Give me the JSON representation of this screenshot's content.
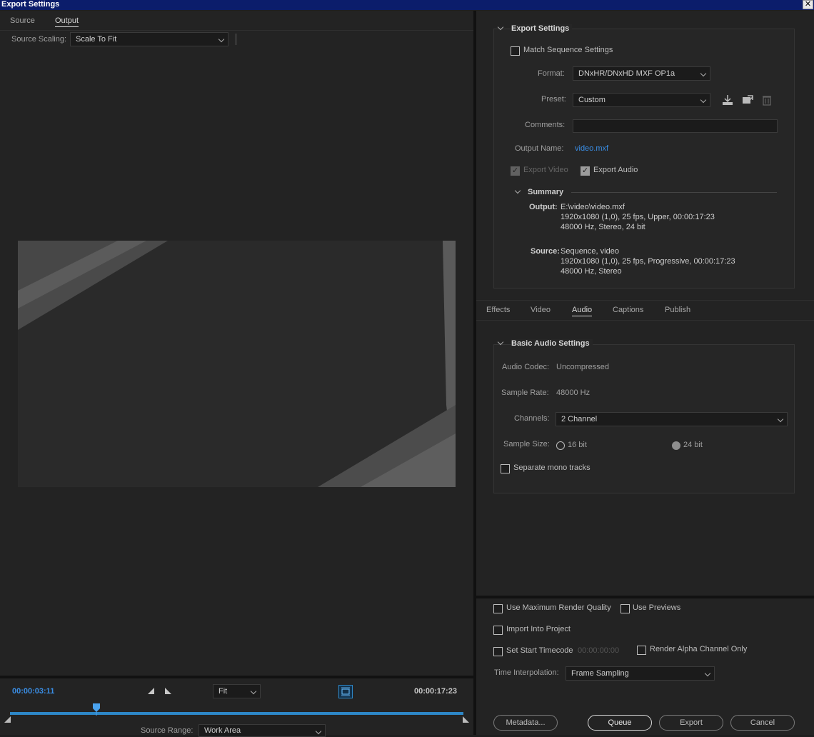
{
  "window": {
    "title": "Export Settings",
    "close_glyph": "✕"
  },
  "left": {
    "tabs": [
      {
        "label": "Source",
        "active": false
      },
      {
        "label": "Output",
        "active": true
      }
    ],
    "source_scaling": {
      "label": "Source Scaling:",
      "value": "Scale To Fit"
    },
    "timeline": {
      "current_time": "00:00:03:11",
      "duration": "00:00:17:23",
      "zoom": "Fit",
      "playhead_fraction": 0.19,
      "source_range": {
        "label": "Source Range:",
        "value": "Work Area"
      }
    }
  },
  "export_settings": {
    "section_title": "Export Settings",
    "match_sequence": {
      "label": "Match Sequence Settings",
      "checked": false
    },
    "format": {
      "label": "Format:",
      "value": "DNxHR/DNxHD MXF OP1a"
    },
    "preset": {
      "label": "Preset:",
      "value": "Custom"
    },
    "comments": {
      "label": "Comments:",
      "value": ""
    },
    "output_name": {
      "label": "Output Name:",
      "value": "video.mxf"
    },
    "export_video": {
      "label": "Export Video",
      "checked": true,
      "disabled": true
    },
    "export_audio": {
      "label": "Export Audio",
      "checked": true
    },
    "summary": {
      "title": "Summary",
      "output_label": "Output:",
      "output_lines": [
        "E:\\video\\video.mxf",
        "1920x1080 (1,0), 25 fps, Upper, 00:00:17:23",
        "48000 Hz, Stereo, 24 bit"
      ],
      "source_label": "Source:",
      "source_lines": [
        "Sequence, video",
        "1920x1080 (1,0), 25 fps, Progressive, 00:00:17:23",
        "48000 Hz, Stereo"
      ]
    }
  },
  "settings_tabs": [
    {
      "label": "Effects",
      "active": false
    },
    {
      "label": "Video",
      "active": false
    },
    {
      "label": "Audio",
      "active": true
    },
    {
      "label": "Captions",
      "active": false
    },
    {
      "label": "Publish",
      "active": false
    }
  ],
  "audio": {
    "section_title": "Basic Audio Settings",
    "codec": {
      "label": "Audio Codec:",
      "value": "Uncompressed"
    },
    "sample_rate": {
      "label": "Sample Rate:",
      "value": "48000 Hz"
    },
    "channels": {
      "label": "Channels:",
      "value": "2 Channel"
    },
    "sample_size": {
      "label": "Sample Size:",
      "options": [
        "16 bit",
        "24 bit"
      ],
      "selected": "24 bit"
    },
    "separate_mono": {
      "label": "Separate mono tracks",
      "checked": false
    }
  },
  "bottom": {
    "max_render_quality": "Use Maximum Render Quality",
    "use_previews": "Use Previews",
    "import_into_project": "Import Into Project",
    "set_start_timecode": "Set Start Timecode",
    "start_timecode_value": "00:00:00:00",
    "render_alpha": "Render Alpha Channel Only",
    "time_interpolation": {
      "label": "Time Interpolation:",
      "value": "Frame Sampling"
    },
    "buttons": {
      "metadata": "Metadata...",
      "queue": "Queue",
      "export": "Export",
      "cancel": "Cancel"
    }
  },
  "colors": {
    "accent": "#3a8ee6",
    "title_bar": "#0b1d6b",
    "timeline_bar": "#2d87c7"
  }
}
